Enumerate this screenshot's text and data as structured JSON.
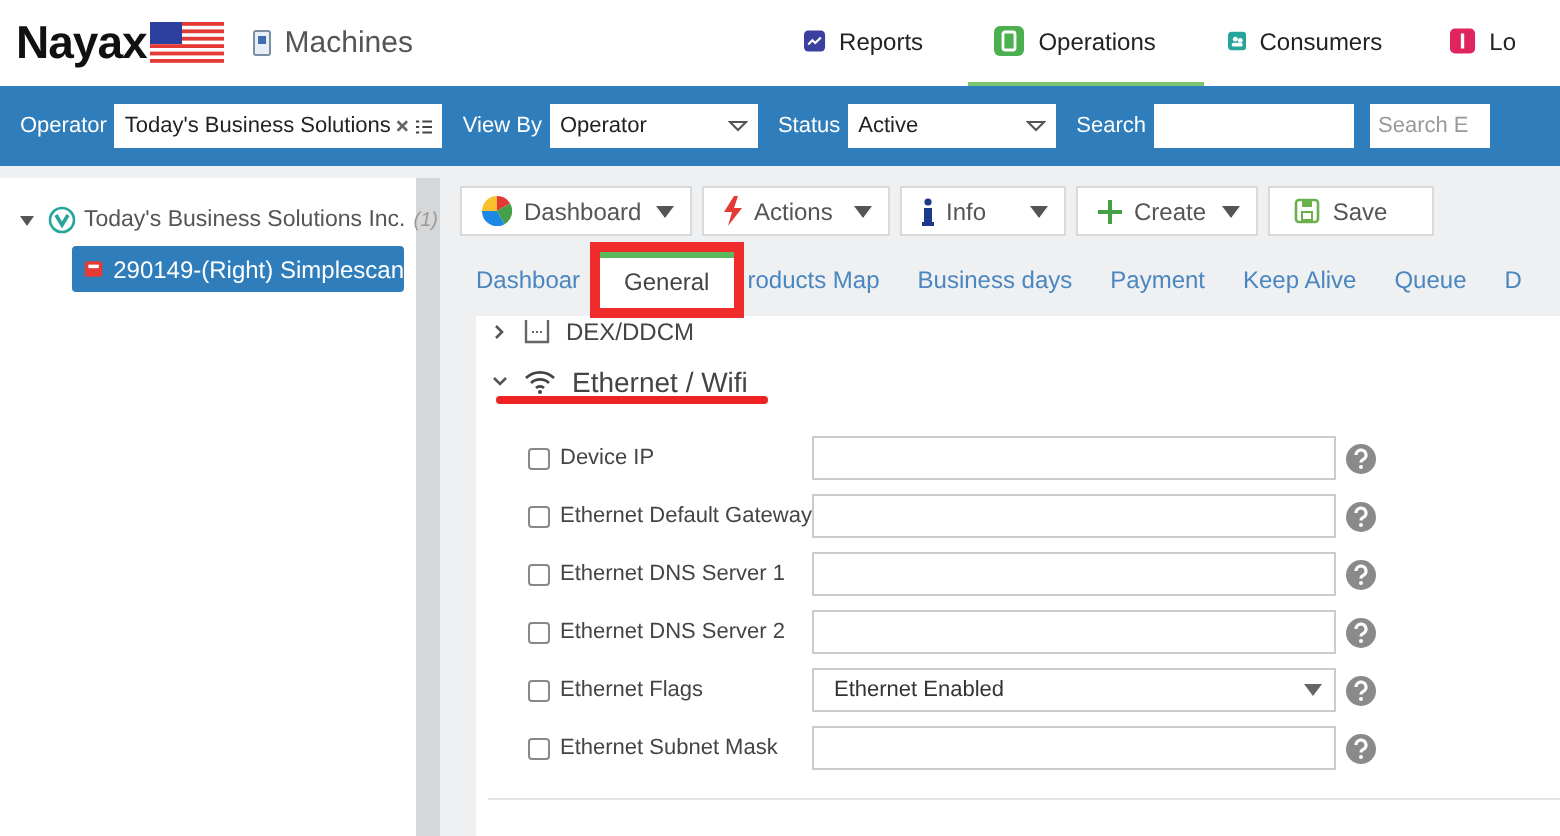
{
  "header": {
    "logo": "Nayax",
    "section": "Machines",
    "nav": [
      {
        "label": "Reports",
        "selected": false,
        "kind": "chart"
      },
      {
        "label": "Operations",
        "selected": true,
        "kind": "ops"
      },
      {
        "label": "Consumers",
        "selected": false,
        "kind": "people"
      },
      {
        "label": "Lo",
        "selected": false,
        "kind": "alert"
      }
    ]
  },
  "filters": {
    "operator_label": "Operator",
    "operator_value": "Today's Business Solutions",
    "view_by_label": "View By",
    "view_by_value": "Operator",
    "status_label": "Status",
    "status_value": "Active",
    "search_label": "Search",
    "search_placeholder": "Search E"
  },
  "tree": [
    {
      "label": "Today's Business Solutions Inc.",
      "count": "(1)",
      "expanded": true,
      "children": [
        {
          "label": "290149-(Right) Simplescan",
          "selected": true
        }
      ]
    }
  ],
  "toolbar": [
    {
      "label": "Dashboard",
      "kind": "pie",
      "dropdown": true
    },
    {
      "label": "Actions",
      "kind": "bolt",
      "dropdown": true
    },
    {
      "label": "Info",
      "kind": "info",
      "dropdown": true
    },
    {
      "label": "Create",
      "kind": "plus",
      "dropdown": true
    },
    {
      "label": "Save",
      "kind": "save",
      "dropdown": false
    }
  ],
  "tabs": [
    {
      "label": "Dashboar",
      "selected": false,
      "highlighted": false
    },
    {
      "label": "General",
      "selected": true,
      "highlighted": true
    },
    {
      "label": "roducts Map",
      "selected": false,
      "highlighted": false
    },
    {
      "label": "Business days",
      "selected": false,
      "highlighted": false
    },
    {
      "label": "Payment",
      "selected": false,
      "highlighted": false
    },
    {
      "label": "Keep Alive",
      "selected": false,
      "highlighted": false
    },
    {
      "label": "Queue",
      "selected": false,
      "highlighted": false
    },
    {
      "label": "D",
      "selected": false,
      "highlighted": false
    }
  ],
  "sections": [
    {
      "title": "DEX/DDCM",
      "kind": "device",
      "expanded": false,
      "underlined": false
    },
    {
      "title": "Ethernet / Wifi",
      "kind": "wifi",
      "expanded": true,
      "underlined": true,
      "fields": [
        {
          "label": "Device IP",
          "checked": false,
          "kind": "text"
        },
        {
          "label": "Ethernet Default Gateway",
          "checked": false,
          "kind": "text"
        },
        {
          "label": "Ethernet DNS Server 1",
          "checked": false,
          "kind": "text"
        },
        {
          "label": "Ethernet DNS Server 2",
          "checked": false,
          "kind": "text"
        },
        {
          "label": "Ethernet Flags",
          "checked": false,
          "kind": "select",
          "value": "Ethernet Enabled"
        },
        {
          "label": "Ethernet Subnet Mask",
          "checked": false,
          "kind": "text"
        }
      ]
    }
  ]
}
